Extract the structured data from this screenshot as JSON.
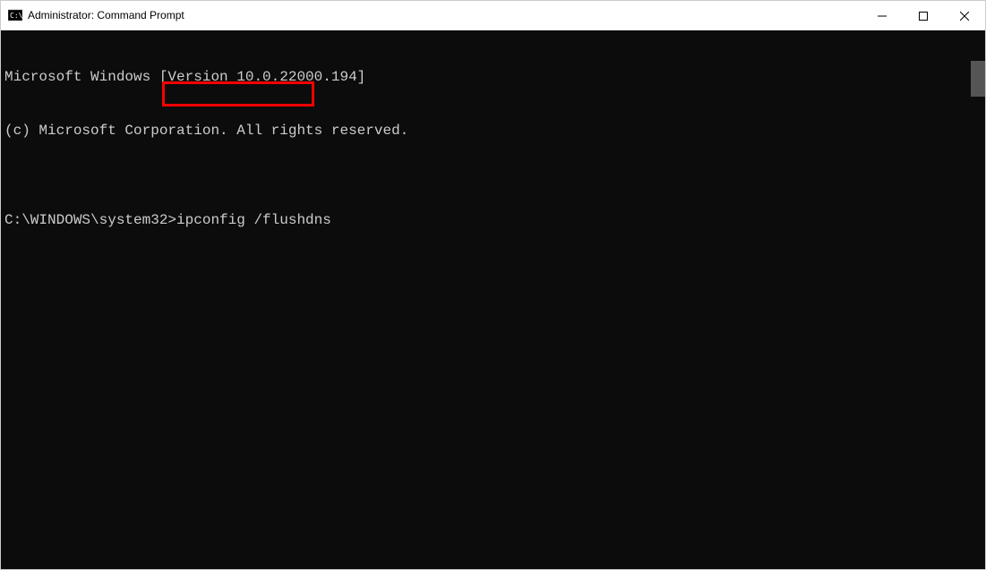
{
  "window": {
    "title": "Administrator: Command Prompt"
  },
  "terminal": {
    "line1": "Microsoft Windows [Version 10.0.22000.194]",
    "line2": "(c) Microsoft Corporation. All rights reserved.",
    "blank": "",
    "prompt": "C:\\WINDOWS\\system32>",
    "command": "ipconfig /flushdns"
  },
  "icons": {
    "cmd": "cmd-icon",
    "minimize": "minimize-icon",
    "maximize": "maximize-icon",
    "close": "close-icon"
  }
}
